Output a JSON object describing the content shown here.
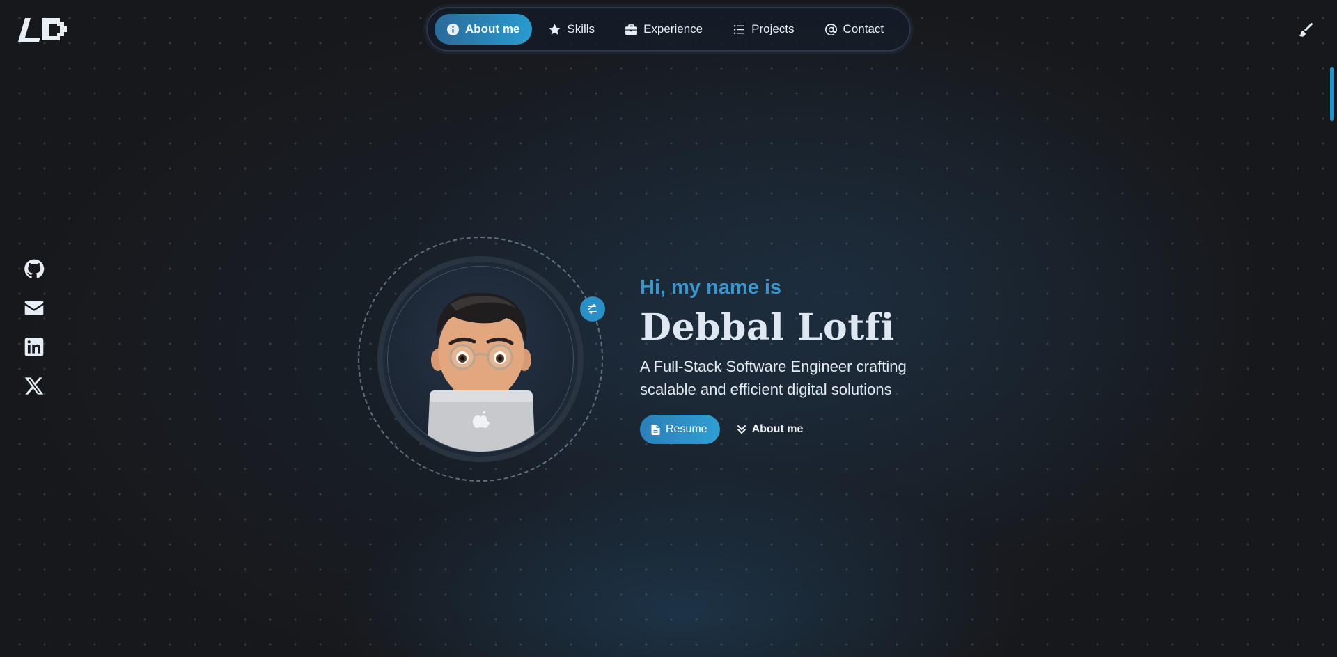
{
  "header": {
    "logo_text": "LD",
    "nav": [
      {
        "label": "About me",
        "icon": "info-circle-icon",
        "active": true
      },
      {
        "label": "Skills",
        "icon": "star-icon",
        "active": false
      },
      {
        "label": "Experience",
        "icon": "briefcase-icon",
        "active": false
      },
      {
        "label": "Projects",
        "icon": "list-icon",
        "active": false
      },
      {
        "label": "Contact",
        "icon": "at-sign-icon",
        "active": false
      }
    ],
    "theme_button_icon": "paintbrush-icon"
  },
  "social": [
    {
      "name": "GitHub",
      "icon": "github-icon"
    },
    {
      "name": "Email",
      "icon": "envelope-icon"
    },
    {
      "name": "LinkedIn",
      "icon": "linkedin-icon"
    },
    {
      "name": "X",
      "icon": "x-twitter-icon"
    }
  ],
  "hero": {
    "greeting": "Hi, my name is",
    "name": "Debbal Lotfi",
    "tagline": "A Full-Stack Software Engineer crafting scalable and efficient digital solutions",
    "resume_label": "Resume",
    "about_label": "About me",
    "avatar_alt": "memoji-avatar-with-laptop",
    "swap_icon": "swap-icon"
  },
  "colors": {
    "accent": "#2a9bd0",
    "greeting": "#3a96cc",
    "background": "#17181b"
  }
}
